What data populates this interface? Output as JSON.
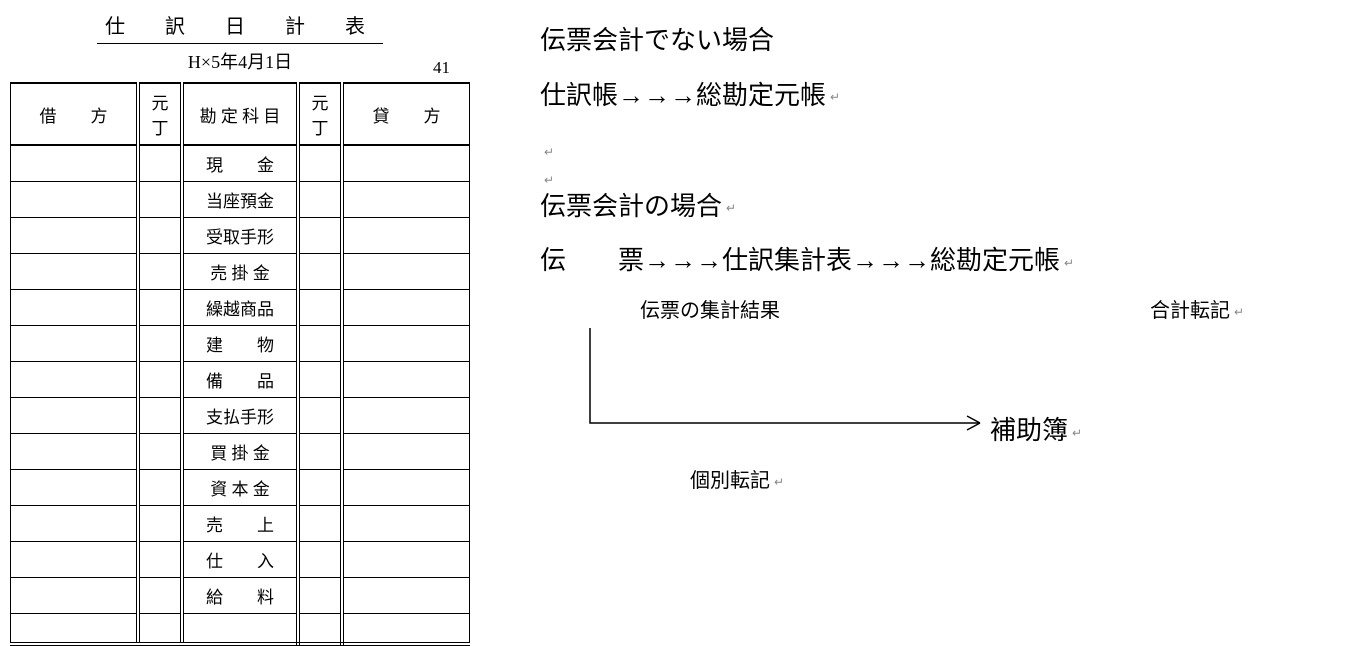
{
  "ledger": {
    "title": "仕　訳　日　計　表",
    "date": "H×5年4月1日",
    "page": "41",
    "headers": {
      "debit": "借　　方",
      "ref1": "元丁",
      "account": "勘 定 科 目",
      "ref2": "元丁",
      "credit": "貸　　方"
    },
    "accounts": [
      "現　　金",
      "当座預金",
      "受取手形",
      "売 掛 金",
      "繰越商品",
      "建　　物",
      "備　　品",
      "支払手形",
      "買 掛 金",
      "資 本 金",
      "売　　上",
      "仕　　入",
      "給　　料"
    ]
  },
  "explain": {
    "sec1_h": "伝票会計でない場合",
    "sec1_flow": "仕訳帳→→→総勘定元帳",
    "sec2_h": "伝票会計の場合",
    "sec2_flow_a": "伝　　票",
    "sec2_flow_b": "→→→仕訳集計表→→→総勘定元帳",
    "lbl_left": "伝票の集計結果",
    "lbl_right": "合計転記",
    "aux": "補助簿",
    "kobetsu": "個別転記"
  }
}
